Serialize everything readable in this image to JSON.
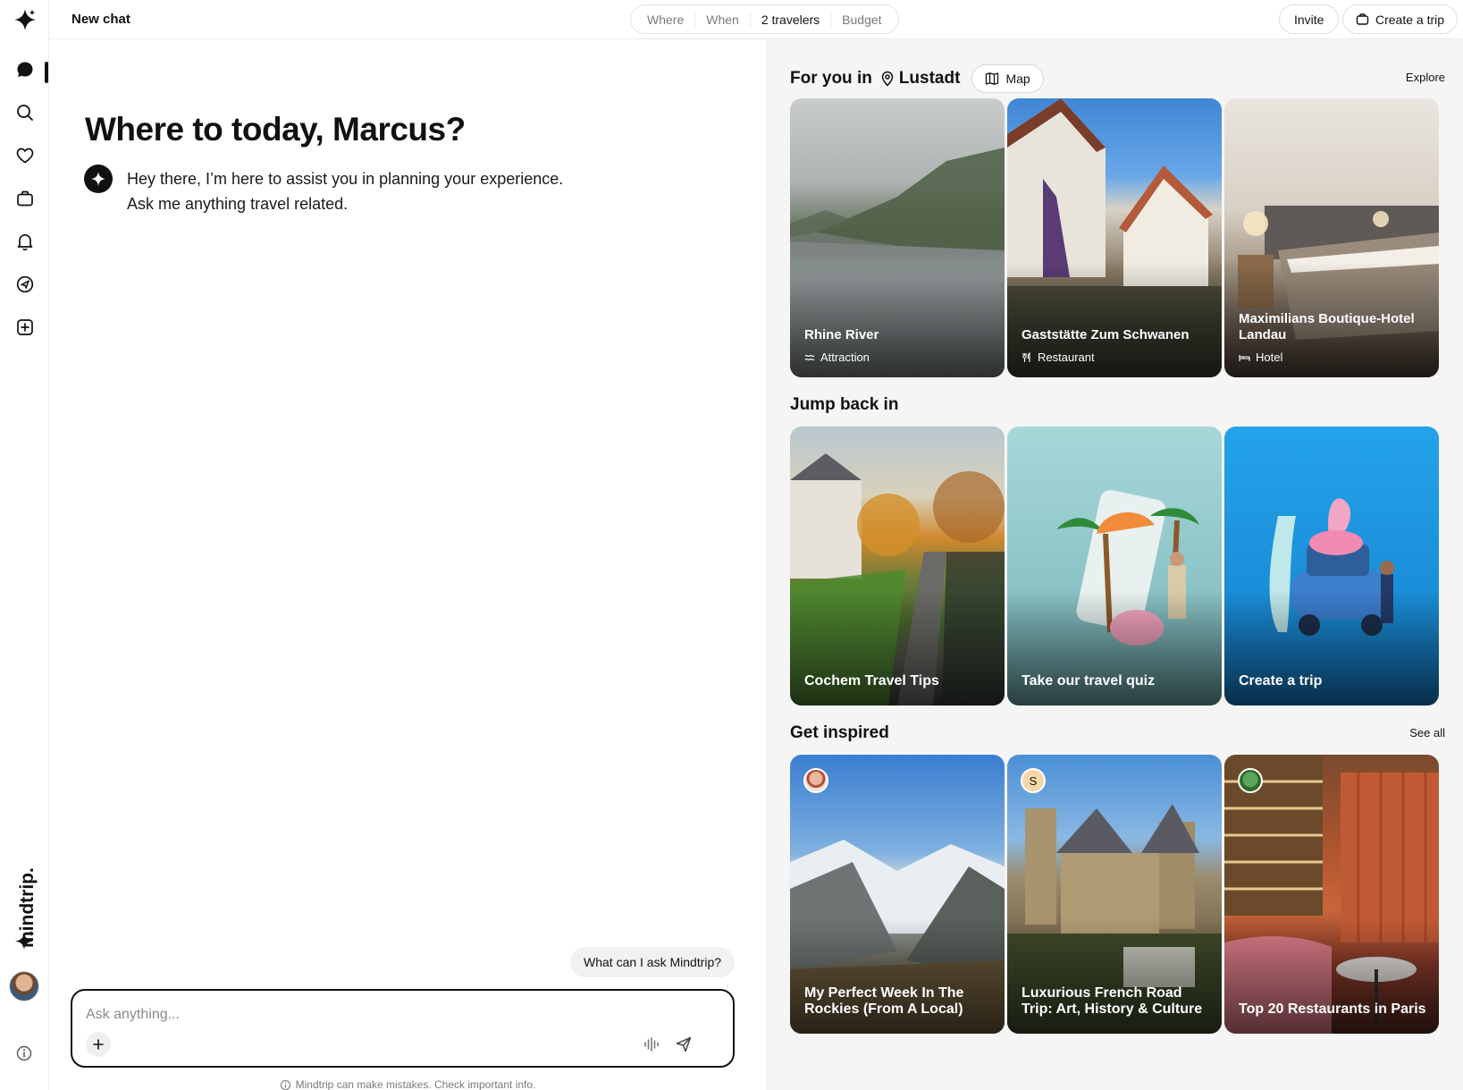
{
  "header": {
    "chat_title": "New chat",
    "trip_pills": [
      "Where",
      "When",
      "2 travelers",
      "Budget"
    ],
    "invite_label": "Invite",
    "create_trip_label": "Create a trip"
  },
  "sidebar": {
    "items": [
      {
        "icon": "chat-icon",
        "active": true
      },
      {
        "icon": "search-icon"
      },
      {
        "icon": "heart-icon"
      },
      {
        "icon": "suitcase-icon"
      },
      {
        "icon": "bell-icon"
      },
      {
        "icon": "navigation-icon"
      },
      {
        "icon": "plus-square-icon"
      }
    ],
    "brand": "mindtrip."
  },
  "chat": {
    "greeting": "Where to today, Marcus?",
    "bot_line1": "Hey there, I’m here to assist you in planning your experience.",
    "bot_line2": "Ask me anything travel related.",
    "suggestion": "What can I ask Mindtrip?",
    "input_placeholder": "Ask anything...",
    "disclaimer": "Mindtrip can make mistakes. Check important info."
  },
  "for_you": {
    "prefix": "For you in",
    "location": "Lustadt",
    "map_label": "Map",
    "explore_label": "Explore",
    "cards": [
      {
        "title": "Rhine River",
        "category": "Attraction",
        "icon": "waves-icon"
      },
      {
        "title": "Gaststätte Zum Schwanen",
        "category": "Restaurant",
        "icon": "utensils-icon"
      },
      {
        "title": "Maximilians Boutique-Hotel Landau",
        "category": "Hotel",
        "icon": "bed-icon"
      }
    ]
  },
  "jump_back": {
    "title": "Jump back in",
    "cards": [
      {
        "title": "Cochem Travel Tips"
      },
      {
        "title": "Take our travel quiz"
      },
      {
        "title": "Create a trip"
      }
    ]
  },
  "inspired": {
    "title": "Get inspired",
    "see_all_label": "See all",
    "cards": [
      {
        "title": "My Perfect Week In The Rockies (From A Local)"
      },
      {
        "title": "Luxurious French Road Trip: Art, History & Culture",
        "author_initial": "S"
      },
      {
        "title": "Top 20 Restaurants in Paris"
      }
    ]
  },
  "colors": {
    "accent": "#111111",
    "panel_bg": "#f5f5f5",
    "quiz_bg": "#8fc9cc",
    "create_bg": "#1f8fe0"
  }
}
